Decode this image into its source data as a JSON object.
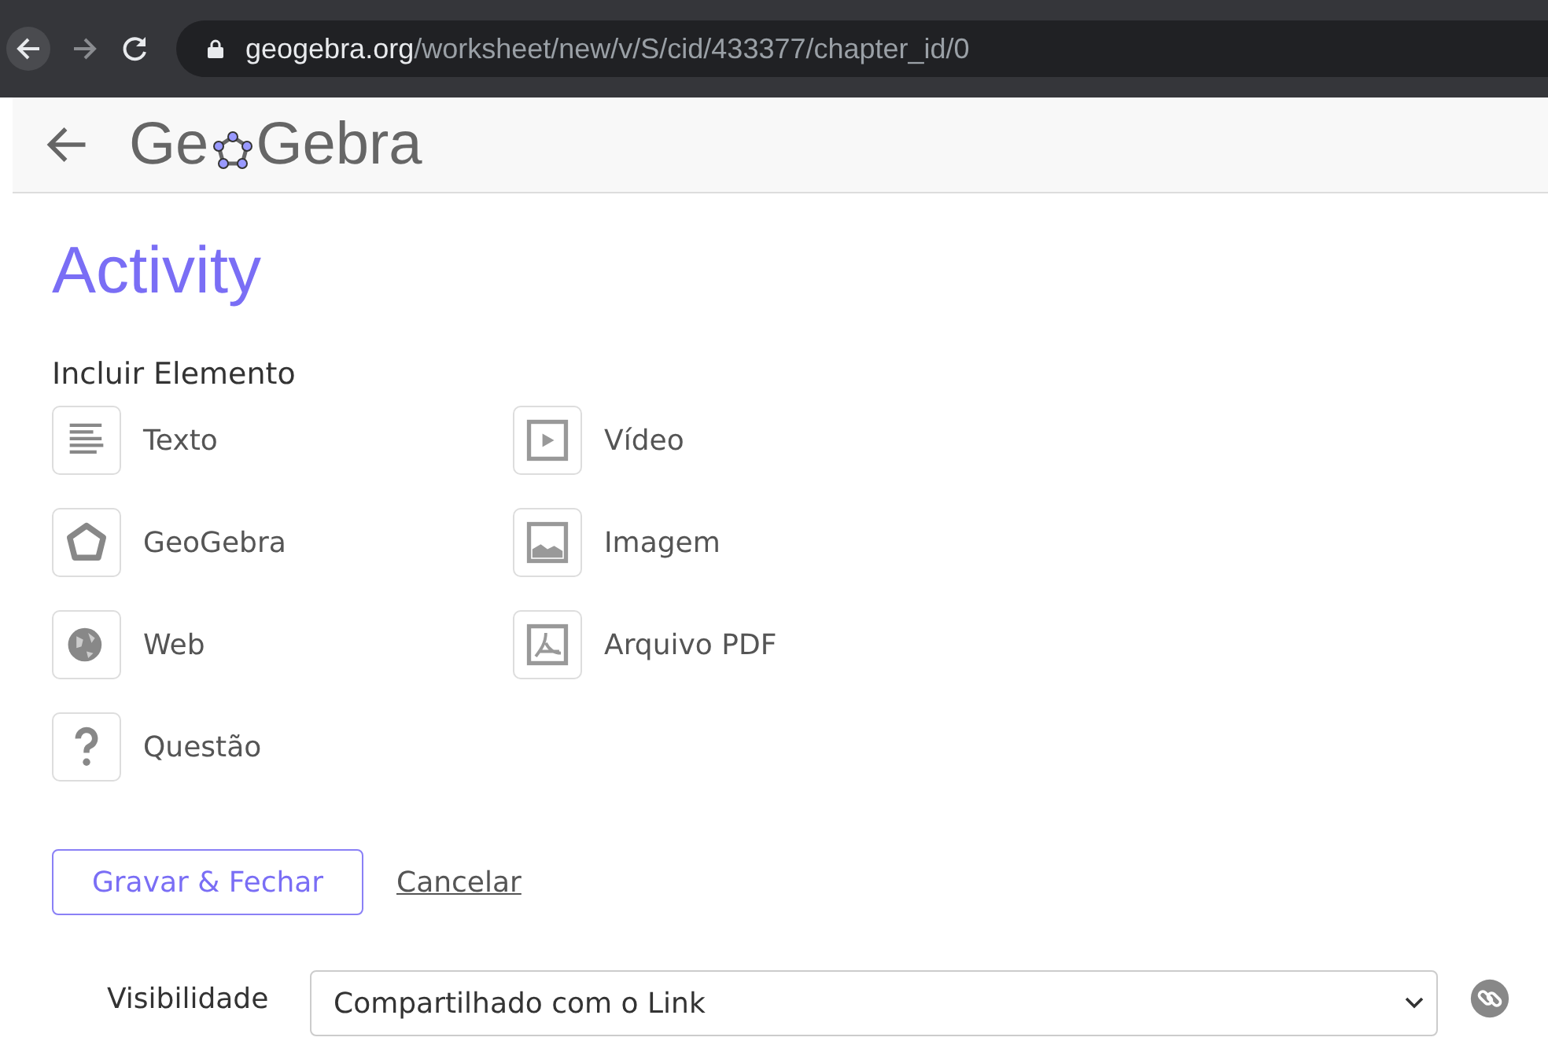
{
  "browser": {
    "url_domain": "geogebra.org",
    "url_path": "/worksheet/new/v/S/cid/433377/chapter_id/0"
  },
  "header": {
    "logo_before": "Ge",
    "logo_after": "Gebra"
  },
  "title": "Activity",
  "section_label": "Incluir Elemento",
  "elements": [
    {
      "kind": "text",
      "label": "Texto"
    },
    {
      "kind": "video",
      "label": "Vídeo"
    },
    {
      "kind": "geogebra",
      "label": "GeoGebra"
    },
    {
      "kind": "image",
      "label": "Imagem"
    },
    {
      "kind": "web",
      "label": "Web"
    },
    {
      "kind": "pdf",
      "label": "Arquivo PDF"
    },
    {
      "kind": "question",
      "label": "Questão"
    }
  ],
  "save_button": "Gravar & Fechar",
  "cancel_link": "Cancelar",
  "visibility": {
    "label": "Visibilidade",
    "value": "Compartilhado com o Link"
  }
}
